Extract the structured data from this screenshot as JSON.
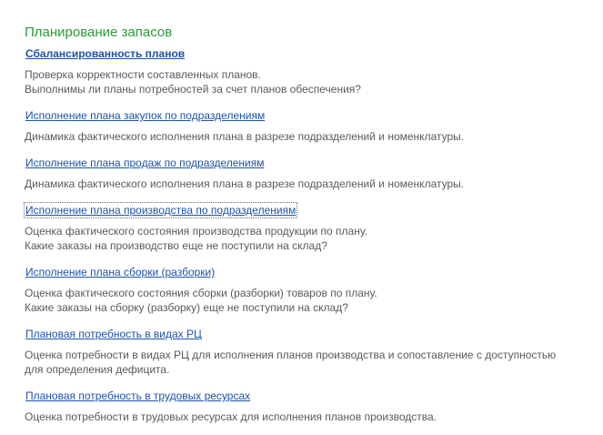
{
  "section": {
    "title": "Планирование запасов"
  },
  "reports": [
    {
      "link": "Сбалансированность планов",
      "desc": [
        "Проверка корректности составленных планов.",
        "Выполнимы ли планы потребностей за счет планов обеспечения?"
      ]
    },
    {
      "link": "Исполнение плана закупок по подразделениям",
      "desc": [
        "Динамика фактического исполнения плана в разрезе подразделений и номенклатуры."
      ]
    },
    {
      "link": "Исполнение плана продаж по подразделениям",
      "desc": [
        "Динамика фактического исполнения плана в разрезе подразделений и номенклатуры."
      ]
    },
    {
      "link": "Исполнение плана производства по подразделениям",
      "desc": [
        "Оценка фактического состояния производства продукции по плану.",
        "Какие заказы на производство еще не поступили на склад?"
      ]
    },
    {
      "link": "Исполнение плана сборки (разборки)",
      "desc": [
        "Оценка фактического состояния сборки (разборки) товаров по плану.",
        "Какие заказы на сборку (разборку) еще не поступили на склад?"
      ]
    },
    {
      "link": "Плановая потребность в видах РЦ",
      "desc": [
        "Оценка потребности в видах РЦ для исполнения планов производства и сопоставление с доступностью",
        "для определения дефицита."
      ]
    },
    {
      "link": "Плановая потребность в трудовых ресурсах",
      "desc": [
        "Оценка потребности в трудовых ресурсах для исполнения планов производства."
      ]
    }
  ]
}
